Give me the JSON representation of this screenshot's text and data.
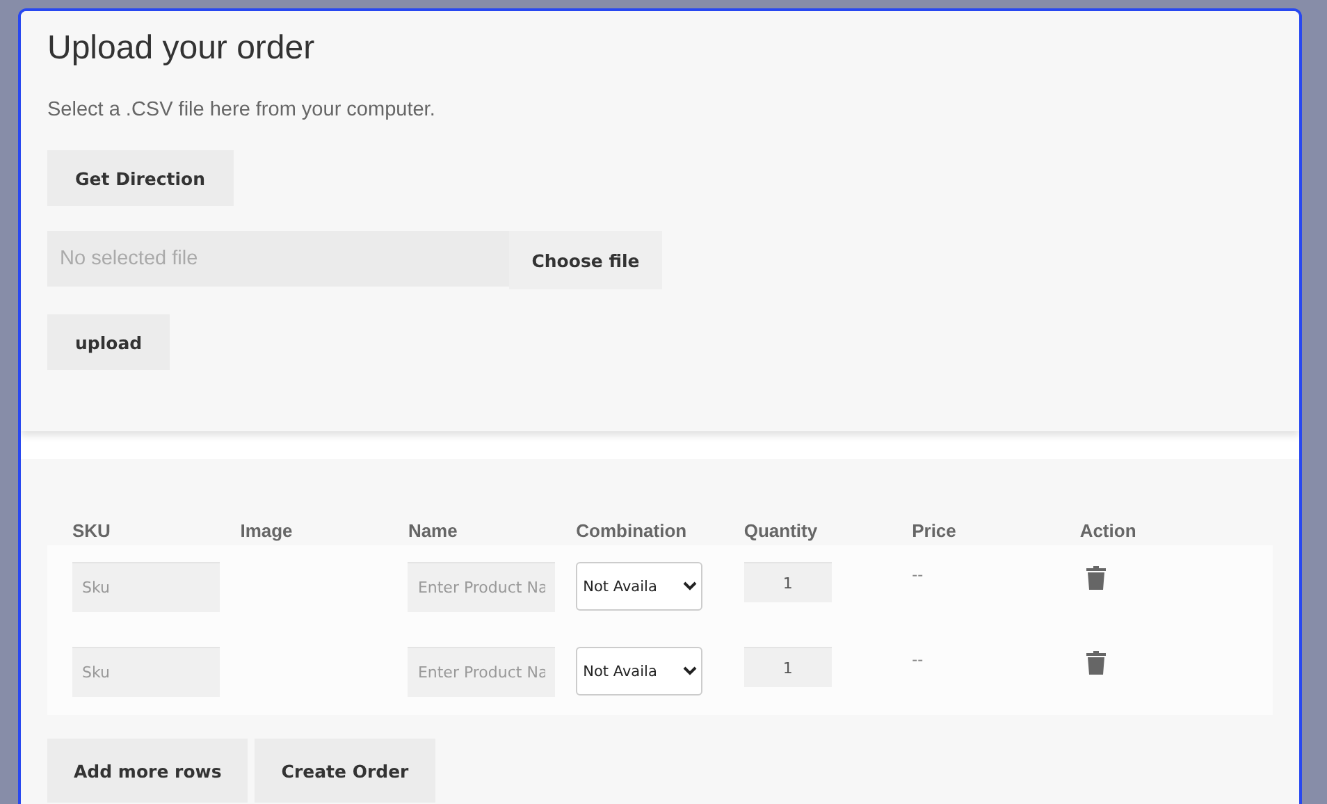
{
  "upload_panel": {
    "title": "Upload your order",
    "description": "Select a .CSV file here from your computer.",
    "direction_button": "Get Direction",
    "file_field": {
      "placeholder": "No selected file"
    },
    "choose_button": "Choose file",
    "upload_button": "upload"
  },
  "table": {
    "columns": [
      "SKU",
      "Image",
      "Name",
      "Combination",
      "Quantity",
      "Price",
      "Action"
    ],
    "rows": [
      {
        "sku": {
          "placeholder": "Sku"
        },
        "name": {
          "placeholder": "Enter Product Na"
        },
        "combination": "Not Availa",
        "quantity": "1",
        "price": "--"
      },
      {
        "sku": {
          "placeholder": "Sku"
        },
        "name": {
          "placeholder": "Enter Product Na"
        },
        "combination": "Not Availa",
        "quantity": "1",
        "price": "--"
      }
    ]
  },
  "buttons": [
    "Add more rows",
    "Create Order"
  ]
}
